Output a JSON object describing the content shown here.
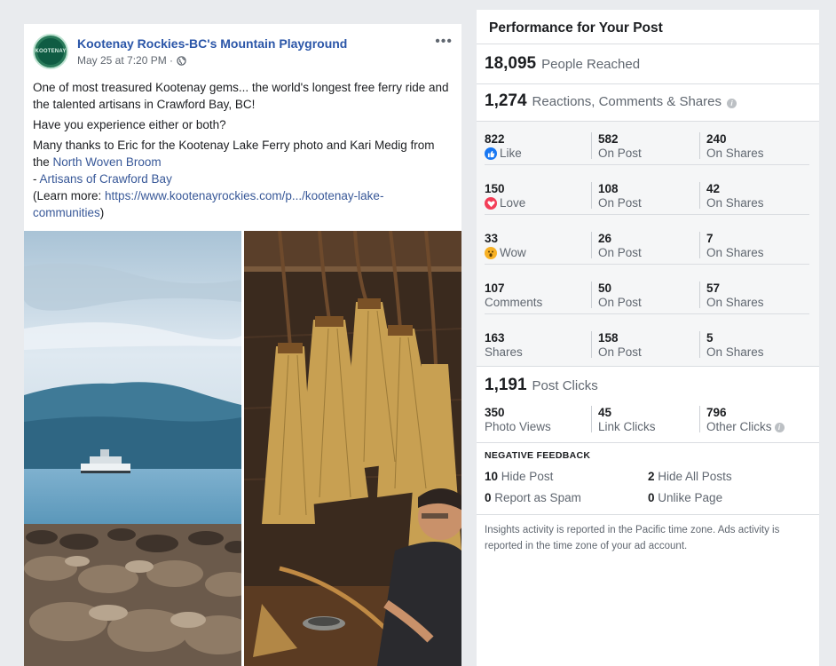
{
  "post": {
    "page_name": "Kootenay Rockies-BC's Mountain Playground",
    "avatar_text": "KOOTENAY",
    "date": "May 25 at 7:20 PM ·",
    "more_label": "•••",
    "text": {
      "line1": "One of most treasured Kootenay gems... the world's longest free ferry ride and the talented artisans in Crawford Bay, BC!",
      "line2": "Have you experience either or both?",
      "line3_prefix": "Many thanks to Eric for the Kootenay Lake Ferry photo and Kari Medig from the ",
      "link_north": "North Woven Broom",
      "dash": "- ",
      "link_artisans": "Artisans of Crawford Bay",
      "learn_prefix": "(Learn more: ",
      "link_url": "https://www.kootenayrockies.com/p.../kootenay-lake-communities",
      "learn_suffix": ")"
    }
  },
  "panel": {
    "title": "Performance for Your Post",
    "reached": {
      "num": "18,095",
      "label": "People Reached"
    },
    "engagement": {
      "num": "1,274",
      "label": "Reactions, Comments & Shares"
    },
    "rows": [
      {
        "c1_val": "822",
        "c1_lbl": "Like",
        "c2_val": "582",
        "c2_lbl": "On Post",
        "c3_val": "240",
        "c3_lbl": "On Shares"
      },
      {
        "c1_val": "150",
        "c1_lbl": "Love",
        "c2_val": "108",
        "c2_lbl": "On Post",
        "c3_val": "42",
        "c3_lbl": "On Shares"
      },
      {
        "c1_val": "33",
        "c1_lbl": "Wow",
        "c2_val": "26",
        "c2_lbl": "On Post",
        "c3_val": "7",
        "c3_lbl": "On Shares"
      },
      {
        "c1_val": "107",
        "c1_lbl": "Comments",
        "c2_val": "50",
        "c2_lbl": "On Post",
        "c3_val": "57",
        "c3_lbl": "On Shares"
      },
      {
        "c1_val": "163",
        "c1_lbl": "Shares",
        "c2_val": "158",
        "c2_lbl": "On Post",
        "c3_val": "5",
        "c3_lbl": "On Shares"
      }
    ],
    "post_clicks": {
      "num": "1,191",
      "label": "Post Clicks"
    },
    "clicks": {
      "c1_val": "350",
      "c1_lbl": "Photo Views",
      "c2_val": "45",
      "c2_lbl": "Link Clicks",
      "c3_val": "796",
      "c3_lbl": "Other Clicks"
    },
    "negative": {
      "title": "NEGATIVE FEEDBACK",
      "hide_post_num": "10",
      "hide_post_lbl": "Hide Post",
      "hide_all_num": "2",
      "hide_all_lbl": "Hide All Posts",
      "spam_num": "0",
      "spam_lbl": "Report as Spam",
      "unlike_num": "0",
      "unlike_lbl": "Unlike Page"
    },
    "footnote": "Insights activity is reported in the Pacific time zone. Ads activity is reported in the time zone of your ad account.",
    "info_glyph": "i"
  },
  "colors": {
    "link": "#385898",
    "like": "#1877f2",
    "love": "#f33e58",
    "wow": "#f7b125"
  }
}
